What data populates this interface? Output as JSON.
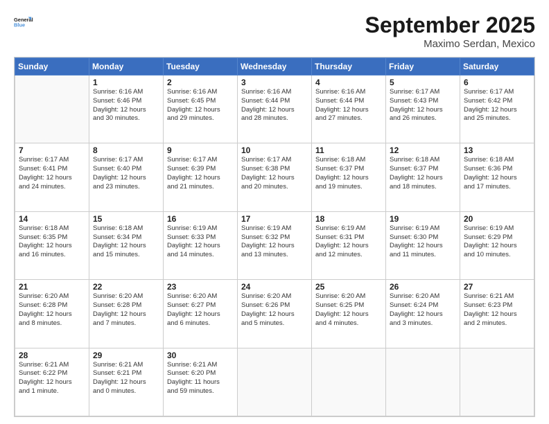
{
  "header": {
    "logo_line1": "General",
    "logo_line2": "Blue",
    "month": "September 2025",
    "location": "Maximo Serdan, Mexico"
  },
  "days_of_week": [
    "Sunday",
    "Monday",
    "Tuesday",
    "Wednesday",
    "Thursday",
    "Friday",
    "Saturday"
  ],
  "weeks": [
    [
      {
        "day": "",
        "info": ""
      },
      {
        "day": "1",
        "info": "Sunrise: 6:16 AM\nSunset: 6:46 PM\nDaylight: 12 hours\nand 30 minutes."
      },
      {
        "day": "2",
        "info": "Sunrise: 6:16 AM\nSunset: 6:45 PM\nDaylight: 12 hours\nand 29 minutes."
      },
      {
        "day": "3",
        "info": "Sunrise: 6:16 AM\nSunset: 6:44 PM\nDaylight: 12 hours\nand 28 minutes."
      },
      {
        "day": "4",
        "info": "Sunrise: 6:16 AM\nSunset: 6:44 PM\nDaylight: 12 hours\nand 27 minutes."
      },
      {
        "day": "5",
        "info": "Sunrise: 6:17 AM\nSunset: 6:43 PM\nDaylight: 12 hours\nand 26 minutes."
      },
      {
        "day": "6",
        "info": "Sunrise: 6:17 AM\nSunset: 6:42 PM\nDaylight: 12 hours\nand 25 minutes."
      }
    ],
    [
      {
        "day": "7",
        "info": "Sunrise: 6:17 AM\nSunset: 6:41 PM\nDaylight: 12 hours\nand 24 minutes."
      },
      {
        "day": "8",
        "info": "Sunrise: 6:17 AM\nSunset: 6:40 PM\nDaylight: 12 hours\nand 23 minutes."
      },
      {
        "day": "9",
        "info": "Sunrise: 6:17 AM\nSunset: 6:39 PM\nDaylight: 12 hours\nand 21 minutes."
      },
      {
        "day": "10",
        "info": "Sunrise: 6:17 AM\nSunset: 6:38 PM\nDaylight: 12 hours\nand 20 minutes."
      },
      {
        "day": "11",
        "info": "Sunrise: 6:18 AM\nSunset: 6:37 PM\nDaylight: 12 hours\nand 19 minutes."
      },
      {
        "day": "12",
        "info": "Sunrise: 6:18 AM\nSunset: 6:37 PM\nDaylight: 12 hours\nand 18 minutes."
      },
      {
        "day": "13",
        "info": "Sunrise: 6:18 AM\nSunset: 6:36 PM\nDaylight: 12 hours\nand 17 minutes."
      }
    ],
    [
      {
        "day": "14",
        "info": "Sunrise: 6:18 AM\nSunset: 6:35 PM\nDaylight: 12 hours\nand 16 minutes."
      },
      {
        "day": "15",
        "info": "Sunrise: 6:18 AM\nSunset: 6:34 PM\nDaylight: 12 hours\nand 15 minutes."
      },
      {
        "day": "16",
        "info": "Sunrise: 6:19 AM\nSunset: 6:33 PM\nDaylight: 12 hours\nand 14 minutes."
      },
      {
        "day": "17",
        "info": "Sunrise: 6:19 AM\nSunset: 6:32 PM\nDaylight: 12 hours\nand 13 minutes."
      },
      {
        "day": "18",
        "info": "Sunrise: 6:19 AM\nSunset: 6:31 PM\nDaylight: 12 hours\nand 12 minutes."
      },
      {
        "day": "19",
        "info": "Sunrise: 6:19 AM\nSunset: 6:30 PM\nDaylight: 12 hours\nand 11 minutes."
      },
      {
        "day": "20",
        "info": "Sunrise: 6:19 AM\nSunset: 6:29 PM\nDaylight: 12 hours\nand 10 minutes."
      }
    ],
    [
      {
        "day": "21",
        "info": "Sunrise: 6:20 AM\nSunset: 6:28 PM\nDaylight: 12 hours\nand 8 minutes."
      },
      {
        "day": "22",
        "info": "Sunrise: 6:20 AM\nSunset: 6:28 PM\nDaylight: 12 hours\nand 7 minutes."
      },
      {
        "day": "23",
        "info": "Sunrise: 6:20 AM\nSunset: 6:27 PM\nDaylight: 12 hours\nand 6 minutes."
      },
      {
        "day": "24",
        "info": "Sunrise: 6:20 AM\nSunset: 6:26 PM\nDaylight: 12 hours\nand 5 minutes."
      },
      {
        "day": "25",
        "info": "Sunrise: 6:20 AM\nSunset: 6:25 PM\nDaylight: 12 hours\nand 4 minutes."
      },
      {
        "day": "26",
        "info": "Sunrise: 6:20 AM\nSunset: 6:24 PM\nDaylight: 12 hours\nand 3 minutes."
      },
      {
        "day": "27",
        "info": "Sunrise: 6:21 AM\nSunset: 6:23 PM\nDaylight: 12 hours\nand 2 minutes."
      }
    ],
    [
      {
        "day": "28",
        "info": "Sunrise: 6:21 AM\nSunset: 6:22 PM\nDaylight: 12 hours\nand 1 minute."
      },
      {
        "day": "29",
        "info": "Sunrise: 6:21 AM\nSunset: 6:21 PM\nDaylight: 12 hours\nand 0 minutes."
      },
      {
        "day": "30",
        "info": "Sunrise: 6:21 AM\nSunset: 6:20 PM\nDaylight: 11 hours\nand 59 minutes."
      },
      {
        "day": "",
        "info": ""
      },
      {
        "day": "",
        "info": ""
      },
      {
        "day": "",
        "info": ""
      },
      {
        "day": "",
        "info": ""
      }
    ]
  ]
}
